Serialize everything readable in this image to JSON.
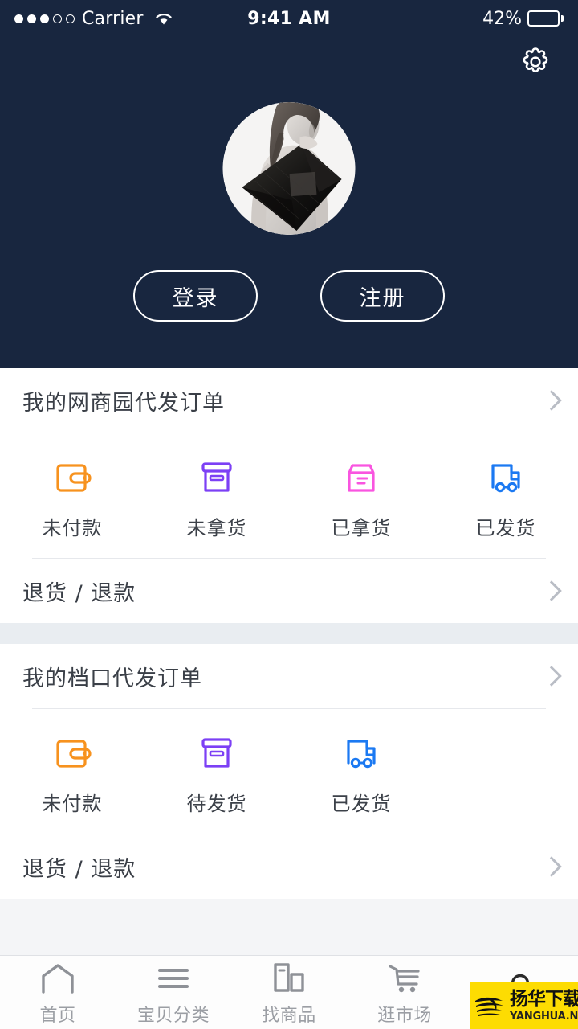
{
  "statusbar": {
    "carrier": "Carrier",
    "signal_filled": 3,
    "signal_total": 5,
    "wifi_icon": "wifi-icon",
    "time": "9:41 AM",
    "battery_percent": "42%",
    "battery_level": 42
  },
  "header": {
    "background_color": "#18263f",
    "settings_icon": "gear-icon",
    "avatar_alt": "user-avatar",
    "login_label": "登录",
    "register_label": "注册"
  },
  "sections": [
    {
      "title": "我的网商园代发订单",
      "items": [
        {
          "label": "未付款",
          "icon": "wallet-icon",
          "color": "#f7921e"
        },
        {
          "label": "未拿货",
          "icon": "box-icon",
          "color": "#7c40f5"
        },
        {
          "label": "已拿货",
          "icon": "box-lines-icon",
          "color": "#f955e0"
        },
        {
          "label": "已发货",
          "icon": "truck-icon",
          "color": "#1b79f2"
        }
      ],
      "footer": "退货 / 退款"
    },
    {
      "title": "我的档口代发订单",
      "items": [
        {
          "label": "未付款",
          "icon": "wallet-icon",
          "color": "#f7921e"
        },
        {
          "label": "待发货",
          "icon": "box-icon",
          "color": "#7c40f5"
        },
        {
          "label": "已发货",
          "icon": "truck-icon",
          "color": "#1b79f2"
        }
      ],
      "footer": "退货 / 退款"
    }
  ],
  "tabbar": {
    "tabs": [
      {
        "label": "首页",
        "icon": "home-icon",
        "active": false
      },
      {
        "label": "宝贝分类",
        "icon": "menu-icon",
        "active": false
      },
      {
        "label": "找商品",
        "icon": "grid-icon",
        "active": false
      },
      {
        "label": "逛市场",
        "icon": "cart-icon",
        "active": false
      },
      {
        "label": "",
        "icon": "person-icon",
        "active": true
      }
    ],
    "inactive_color": "#9b9ea4",
    "active_color": "#2b2b2b"
  },
  "watermark": {
    "cn": "扬华下载",
    "en": "YANGHUA.NET",
    "background_color": "#fddc02"
  }
}
